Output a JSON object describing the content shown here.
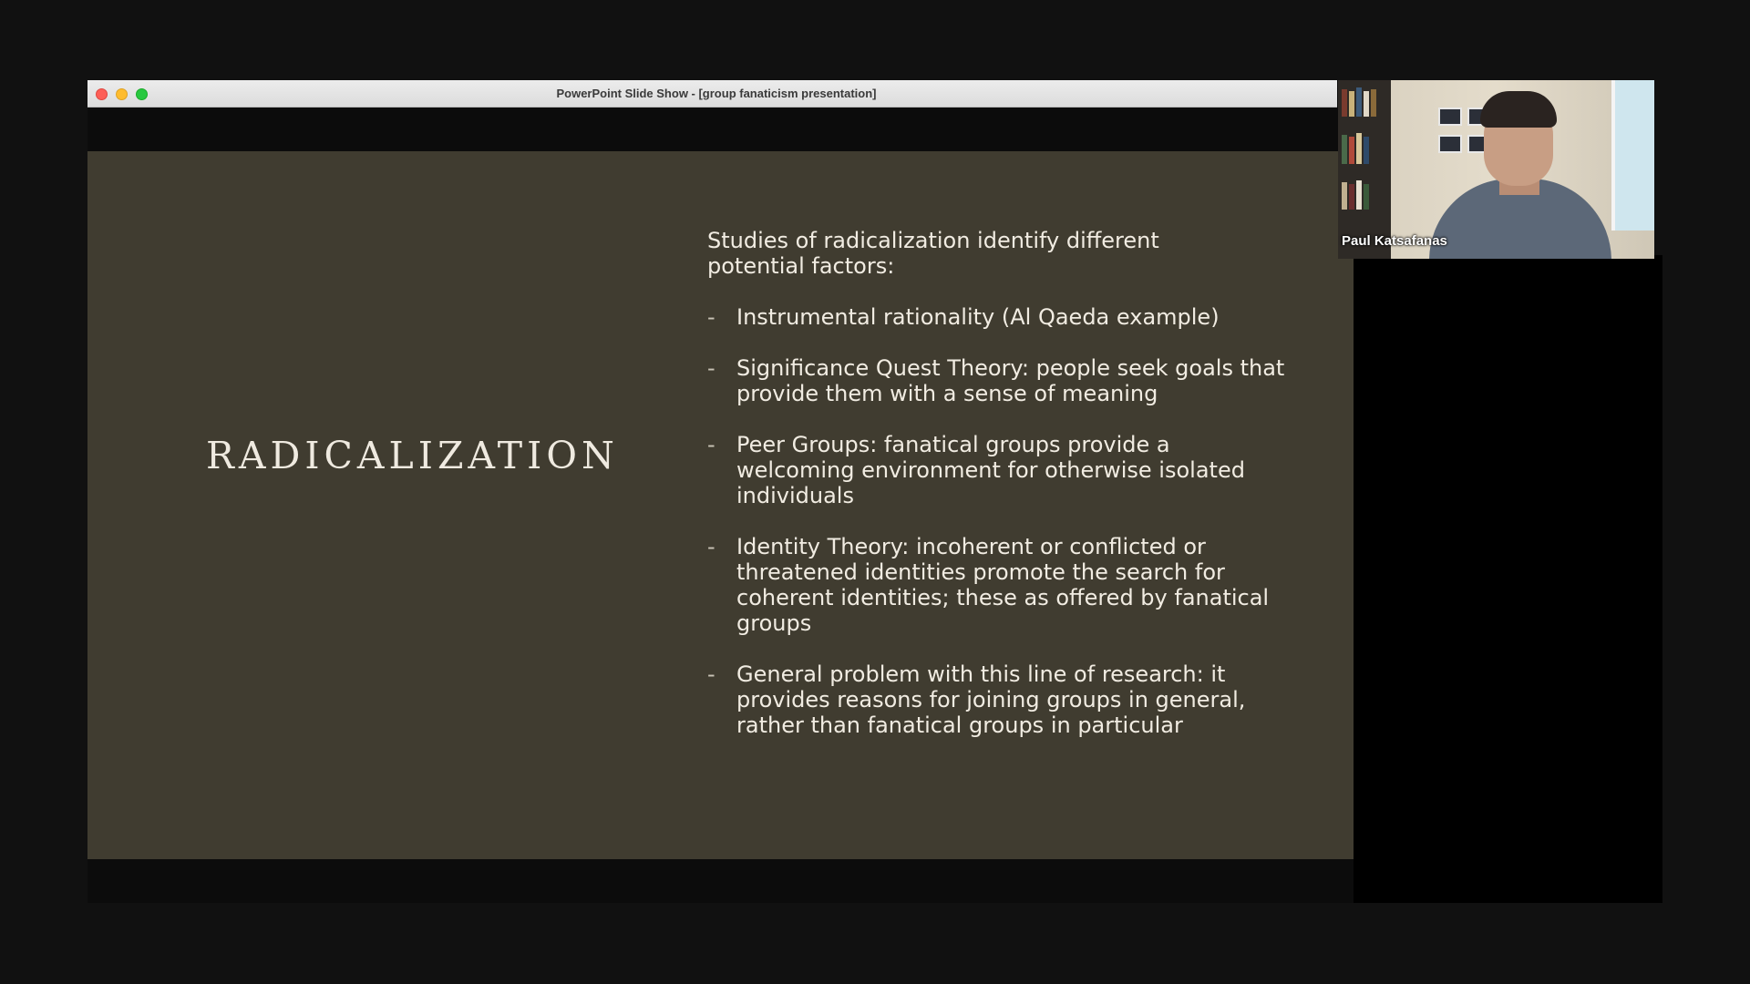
{
  "window": {
    "title": "PowerPoint Slide Show - [group fanaticism presentation]"
  },
  "slide": {
    "title": "RADICALIZATION",
    "intro": "Studies of radicalization identify different potential factors:",
    "bullet_marker": "-",
    "bullets": [
      "Instrumental rationality  (Al Qaeda example)",
      "Significance Quest Theory: people seek goals that provide them with a sense of meaning",
      "Peer Groups: fanatical groups provide a welcoming environment for otherwise isolated individuals",
      "Identity Theory: incoherent or conflicted or threatened identities promote the search for coherent identities; these as offered by fanatical groups",
      "General problem with this line of research: it provides reasons for joining groups in general, rather than fanatical groups in particular"
    ]
  },
  "video": {
    "participant_name": "Paul Katsafanas"
  },
  "colors": {
    "slide_background": "#403c30",
    "slide_text": "#f1ece2",
    "screen_background": "#111111"
  }
}
